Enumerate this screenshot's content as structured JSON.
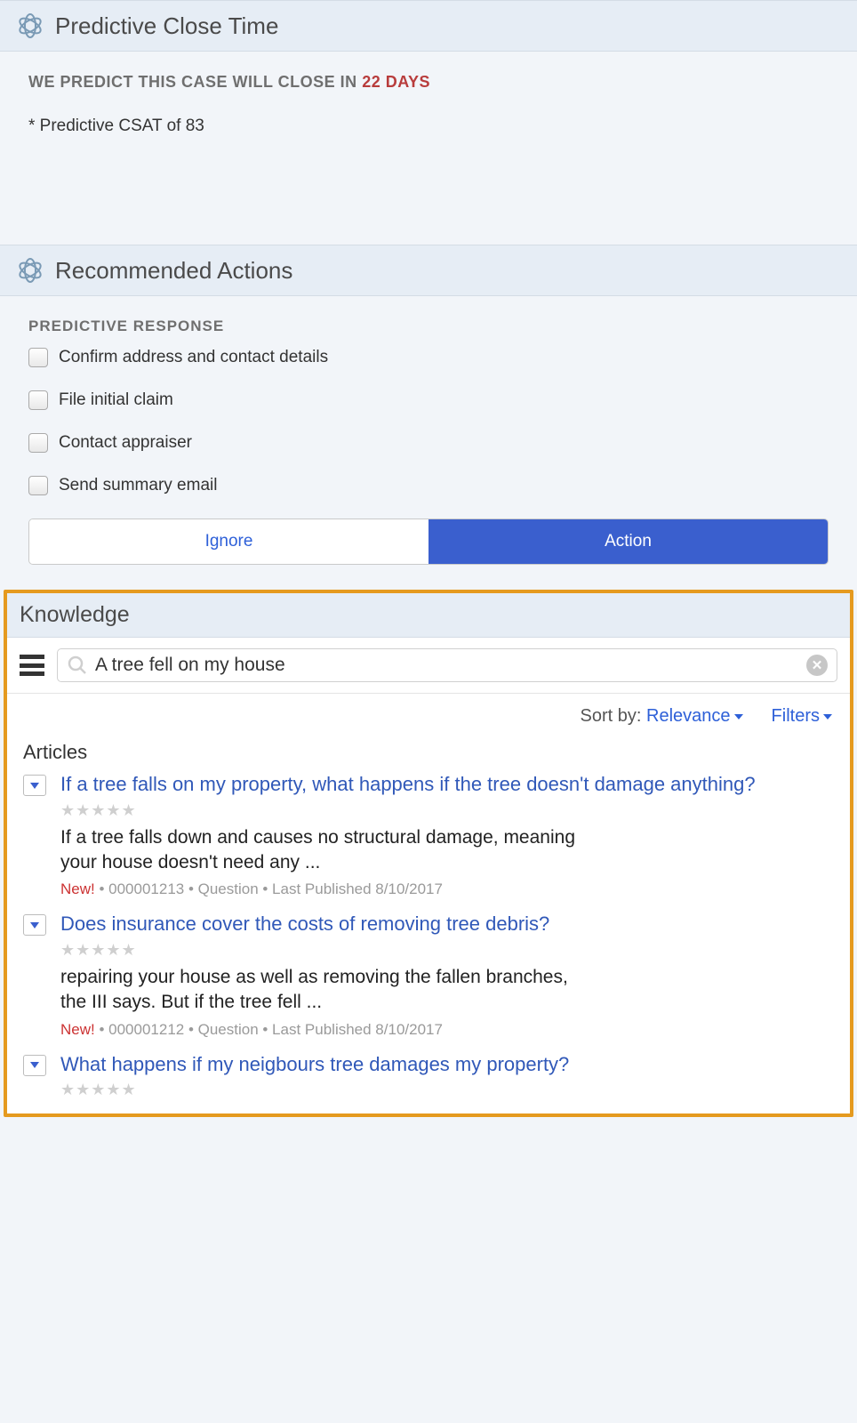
{
  "predictive_close": {
    "title": "Predictive Close Time",
    "predict_prefix": "WE PREDICT THIS CASE WILL CLOSE IN ",
    "predict_days": "22 DAYS",
    "csat_line": "* Predictive CSAT of 83"
  },
  "recommended": {
    "title": "Recommended Actions",
    "heading": "PREDICTIVE RESPONSE",
    "items": [
      "Confirm address and contact details",
      "File initial claim",
      "Contact appraiser",
      "Send summary email"
    ],
    "ignore_label": "Ignore",
    "action_label": "Action"
  },
  "knowledge": {
    "title": "Knowledge",
    "search_value": "A tree fell on my house",
    "sort_by_label": "Sort by:",
    "sort_value": "Relevance",
    "filters_label": "Filters",
    "articles_heading": "Articles",
    "articles": [
      {
        "title": "If a tree falls on my property, what happens if the tree doesn't damage anything?",
        "snippet": "If a tree falls down and causes no structural damage, meaning your house doesn't need any ...",
        "new": "New!",
        "meta": " • 000001213 • Question • Last Published 8/10/2017"
      },
      {
        "title": "Does insurance cover the costs of removing tree debris?",
        "snippet": "repairing your house as well as removing the fallen branches, the III says. But if the tree fell ...",
        "new": "New!",
        "meta": " • 000001212 • Question • Last Published 8/10/2017"
      },
      {
        "title": "What happens if my neigbours tree damages my property?",
        "snippet": "",
        "new": "",
        "meta": ""
      }
    ]
  }
}
